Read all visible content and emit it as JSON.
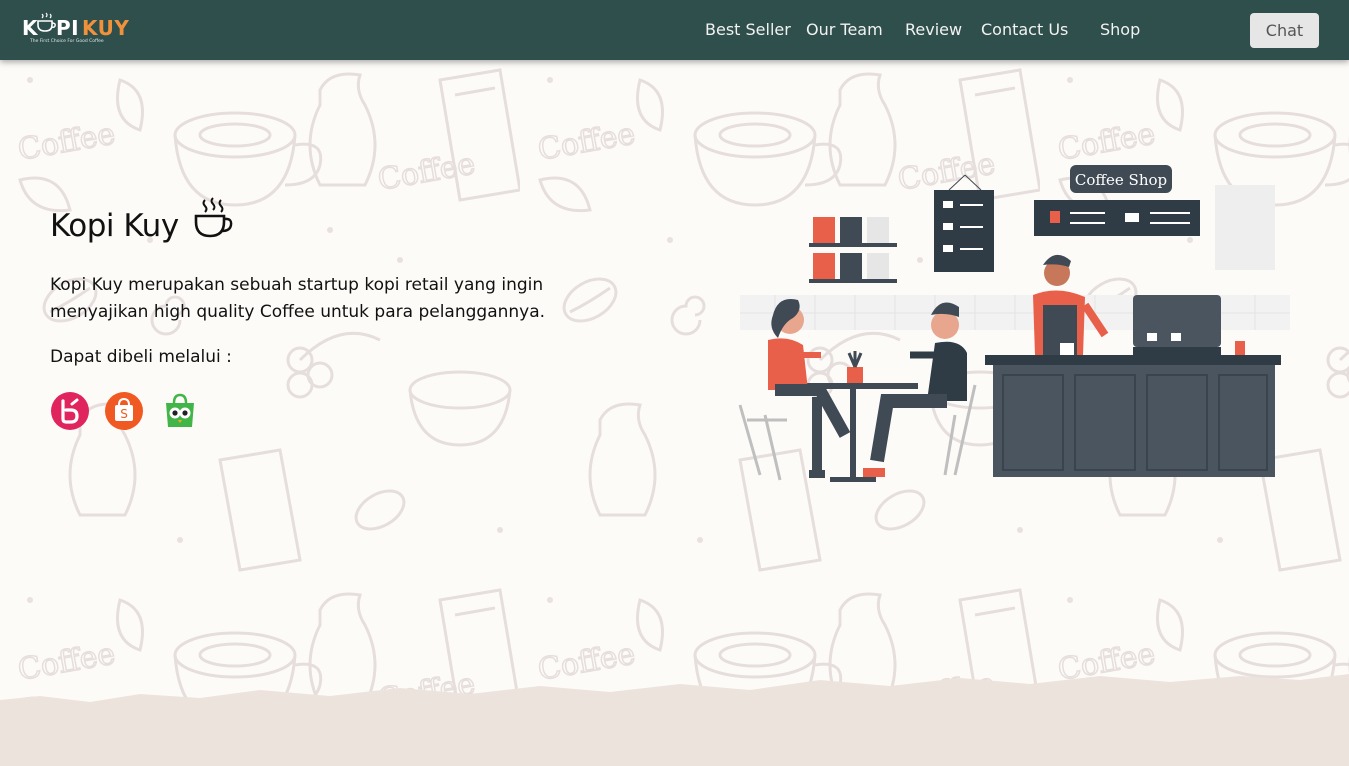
{
  "brand": {
    "logo_text_k": "K",
    "logo_text_pi": "PI",
    "logo_text_kuy": "KUY",
    "tagline": "The First Choice For Good Coffee"
  },
  "nav": {
    "links": [
      "Best Seller",
      "Our Team",
      "Review",
      "Contact Us",
      "Shop"
    ],
    "chat_label": "Chat"
  },
  "hero": {
    "title": "Kopi Kuy",
    "description": "Kopi Kuy merupakan sebuah startup kopi retail yang ingin menyajikan high quality Coffee untuk para pelanggannya.",
    "buy_label": "Dapat dibeli melalui :",
    "stores": [
      "blibli-icon",
      "shopee-icon",
      "tokopedia-icon"
    ]
  },
  "illustration": {
    "sign_text": "Coffee Shop",
    "pattern_word": "Coffee"
  },
  "colors": {
    "navbar": "#2f4f4c",
    "accent": "#f0913b",
    "background": "#fdfbf8",
    "footer_band": "#ece3dc"
  }
}
